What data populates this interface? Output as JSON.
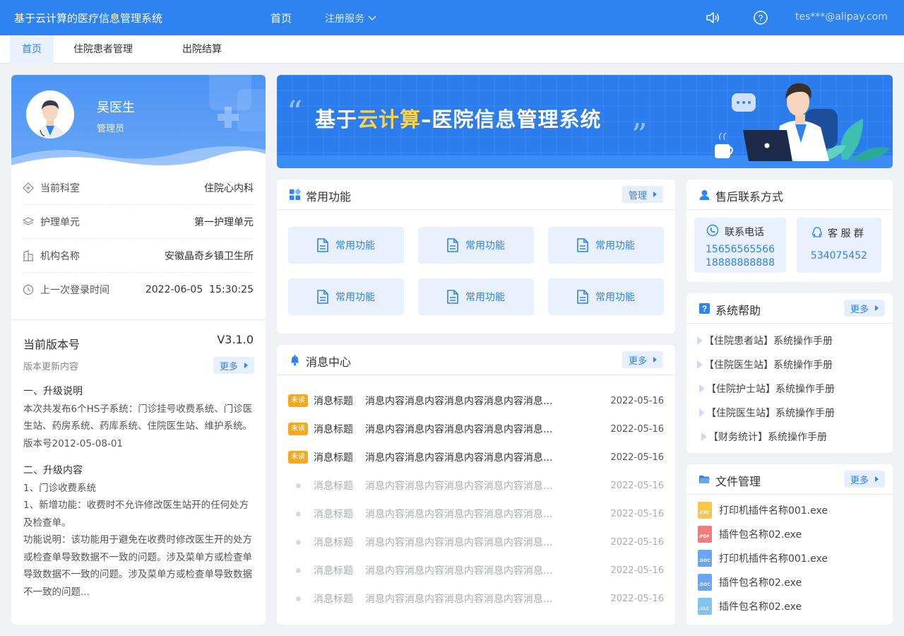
{
  "header": {
    "app_title": "基于云计算的医疗信息管理系统",
    "nav_home": "首页",
    "nav_register": "注册服务",
    "user_email": "tes***@alipay.com"
  },
  "tabs": [
    {
      "label": "首页",
      "active": true
    },
    {
      "label": "住院患者管理",
      "active": false
    },
    {
      "label": "出院结算",
      "active": false
    }
  ],
  "profile": {
    "name": "吴医生",
    "role": "管理员",
    "info": [
      {
        "icon": "department-icon",
        "label": "当前科室",
        "value": "住院心内科"
      },
      {
        "icon": "layers-icon",
        "label": "护理单元",
        "value": "第一护理单元"
      },
      {
        "icon": "building-icon",
        "label": "机构名称",
        "value": "安徽晶奇乡镇卫生所"
      },
      {
        "icon": "clock-icon",
        "label": "上一次登录时间",
        "value": "2022-06-05  15:30:25"
      }
    ]
  },
  "version": {
    "title": "当前版本号",
    "number": "V3.1.0",
    "subtitle": "版本更新内容",
    "more": "更多",
    "section1_title": "一、升级说明",
    "section1_body": "本次共发布6个HS子系统：门诊挂号收费系统、门诊医生站、药房系统、药库系统、住院医生站、维护系统。版本号2012-05-08-01",
    "section2_title": "二、升级内容",
    "section2_line1": "1、门诊收费系统",
    "section2_line2": "1、新增功能：收费时不允许修改医生站开的任何处方及检查单。",
    "section2_line3": "功能说明：该功能用于避免在收费时修改医生开的处方或检查单导致数据不一致的问题。涉及菜单方或检查单导致数据不一致的问题。涉及菜单方或检查单导致数据不一致的问题..."
  },
  "banner": {
    "title_prefix": "基于",
    "title_highlight": "云计算",
    "title_suffix": "–医院信息管理系统"
  },
  "functions": {
    "title": "常用功能",
    "manage": "管理",
    "items": [
      "常用功能",
      "常用功能",
      "常用功能",
      "常用功能",
      "常用功能",
      "常用功能"
    ]
  },
  "messages": {
    "title": "消息中心",
    "more": "更多",
    "unread_label": "未读",
    "items": [
      {
        "unread": true,
        "title": "消息标题",
        "content": "消息内容消息内容消息内容消息内容消息...",
        "date": "2022-05-16"
      },
      {
        "unread": true,
        "title": "消息标题",
        "content": "消息内容消息内容消息内容消息内容消息...",
        "date": "2022-05-16"
      },
      {
        "unread": true,
        "title": "消息标题",
        "content": "消息内容消息内容消息内容消息内容消息...",
        "date": "2022-05-16"
      },
      {
        "unread": false,
        "title": "消息标题",
        "content": "消息内容消息内容消息内容消息内容消息...",
        "date": "2022-05-16"
      },
      {
        "unread": false,
        "title": "消息标题",
        "content": "消息内容消息内容消息内容消息内容消息...",
        "date": "2022-05-16"
      },
      {
        "unread": false,
        "title": "消息标题",
        "content": "消息内容消息内容消息内容消息内容消息...",
        "date": "2022-05-16"
      },
      {
        "unread": false,
        "title": "消息标题",
        "content": "消息内容消息内容消息内容消息内容消息...",
        "date": "2022-05-16"
      },
      {
        "unread": false,
        "title": "消息标题",
        "content": "消息内容消息内容消息内容消息内容消息...",
        "date": "2022-05-16"
      }
    ]
  },
  "contact": {
    "title": "售后联系方式",
    "phone_label": "联系电话",
    "phone1": "15656565566",
    "phone2": "18888888888",
    "group_label": "客 服 群",
    "group_number": "534075452"
  },
  "help": {
    "title": "系统帮助",
    "more": "更多",
    "items": [
      "【住院患者站】系统操作手册",
      "【住院医生站】系统操作手册",
      "【住院护士站】系统操作手册",
      "【住院医生站】系统操作手册",
      "【财务统计】系统操作手册"
    ]
  },
  "files": {
    "title": "文件管理",
    "more": "更多",
    "items": [
      {
        "name": "打印机插件名称001.exe",
        "ext": ".EXE",
        "color": "#f7c64b"
      },
      {
        "name": "插件包名称02.exe",
        "ext": ".PDF",
        "color": "#f27b7b"
      },
      {
        "name": "打印机插件名称001.exe",
        "ext": ".DOC",
        "color": "#6aa5f2"
      },
      {
        "name": "插件包名称02.exe",
        "ext": ".DOC",
        "color": "#6aa5f2"
      },
      {
        "name": "插件包名称02.exe",
        "ext": ".XLC",
        "color": "#7fc3f0"
      }
    ]
  },
  "colors": {
    "primary": "#2f83f0",
    "unread_badge": "#f7a81b",
    "banner_highlight": "#ffd34a"
  }
}
